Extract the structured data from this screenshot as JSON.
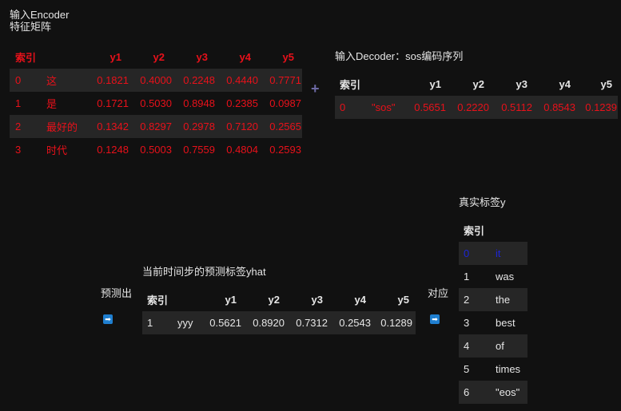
{
  "encoder": {
    "caption_line1": "输入Encoder",
    "caption_line2": "特征矩阵",
    "headers": [
      "索引",
      "",
      "y1",
      "y2",
      "y3",
      "y4",
      "y5"
    ],
    "rows": [
      [
        "0",
        "这",
        "0.1821",
        "0.4000",
        "0.2248",
        "0.4440",
        "0.7771"
      ],
      [
        "1",
        "是",
        "0.1721",
        "0.5030",
        "0.8948",
        "0.2385",
        "0.0987"
      ],
      [
        "2",
        "最好的",
        "0.1342",
        "0.8297",
        "0.2978",
        "0.7120",
        "0.2565"
      ],
      [
        "3",
        "时代",
        "0.1248",
        "0.5003",
        "0.7559",
        "0.4804",
        "0.2593"
      ]
    ]
  },
  "plus_symbol": "+",
  "decoder": {
    "caption": "输入Decoder：sos编码序列",
    "headers": [
      "索引",
      "",
      "y1",
      "y2",
      "y3",
      "y4",
      "y5"
    ],
    "rows": [
      [
        "0",
        "\"sos\"",
        "0.5651",
        "0.2220",
        "0.5112",
        "0.8543",
        "0.1239"
      ]
    ]
  },
  "predict_label": "预测出",
  "arrow_glyph": "➡",
  "yhat": {
    "caption": "当前时间步的预测标签yhat",
    "headers": [
      "索引",
      "",
      "y1",
      "y2",
      "y3",
      "y4",
      "y5"
    ],
    "rows": [
      [
        "1",
        "yyy",
        "0.5621",
        "0.8920",
        "0.7312",
        "0.2543",
        "0.1289"
      ]
    ]
  },
  "match_label": "对应",
  "truth": {
    "caption": "真实标签y",
    "headers": [
      "索引",
      ""
    ],
    "rows": [
      [
        "0",
        "it"
      ],
      [
        "1",
        "was"
      ],
      [
        "2",
        "the"
      ],
      [
        "3",
        "best"
      ],
      [
        "4",
        "of"
      ],
      [
        "5",
        "times"
      ],
      [
        "6",
        "\"eos\""
      ]
    ]
  },
  "colors": {
    "encoder_text": "#e8111a",
    "highlight_row": "#1d25d6",
    "background": "#111111",
    "stripe": "#262626"
  }
}
